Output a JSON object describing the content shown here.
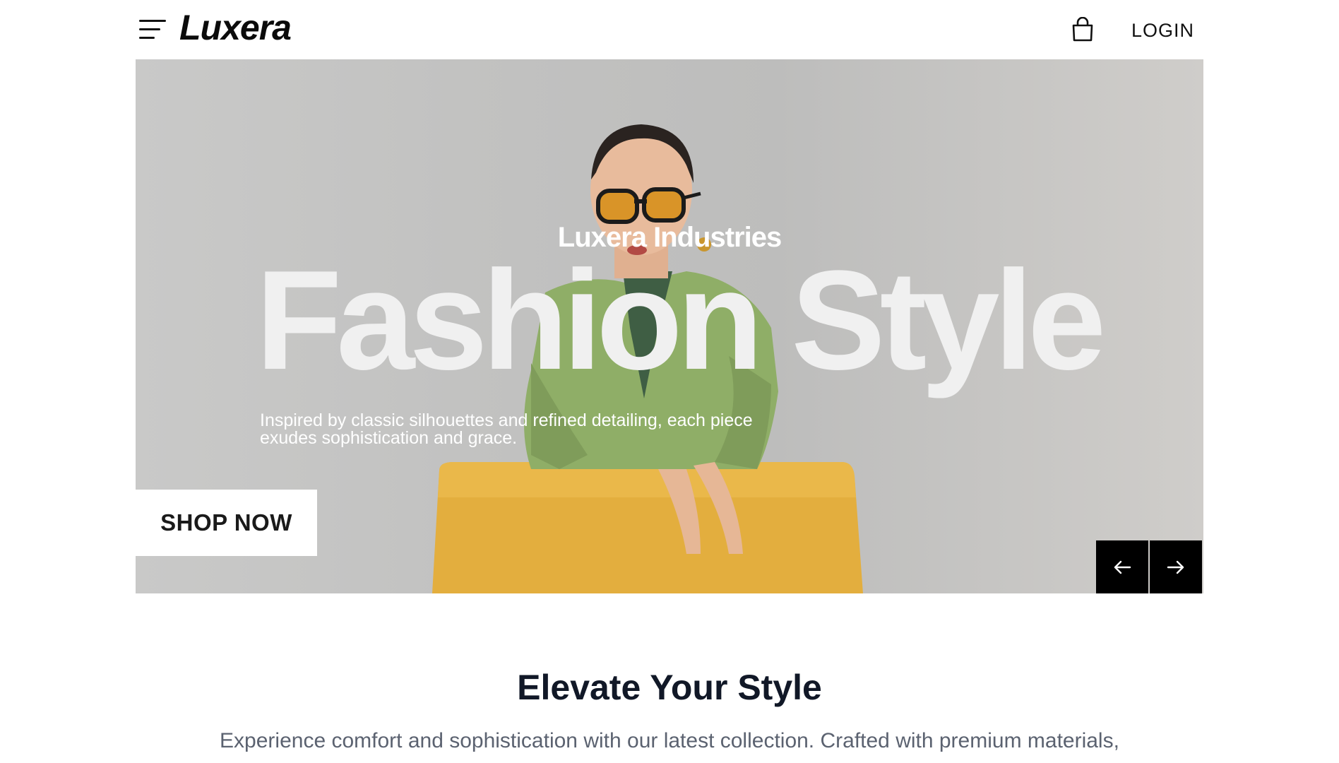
{
  "header": {
    "logo": "Luxera",
    "menu_icon": "hamburger-menu-icon",
    "cart_icon": "shopping-bag-icon",
    "login_label": "LOGIN"
  },
  "hero": {
    "kicker": "Luxera Industries",
    "headline": "Fashion Style",
    "description": "Inspired by classic silhouettes and refined detailing, each piece exudes sophistication and grace.",
    "cta_label": "SHOP NOW",
    "prev_icon": "arrow-left-icon",
    "next_icon": "arrow-right-icon"
  },
  "section": {
    "title": "Elevate Your Style",
    "text": "Experience comfort and sophistication with our latest collection. Crafted with premium materials,"
  },
  "colors": {
    "background": "#ffffff",
    "hero_bg": "#c4c4c3",
    "accent_dark": "#000000",
    "cta_bg": "#ffffff",
    "title": "#111827",
    "body_text": "#5b6270"
  }
}
